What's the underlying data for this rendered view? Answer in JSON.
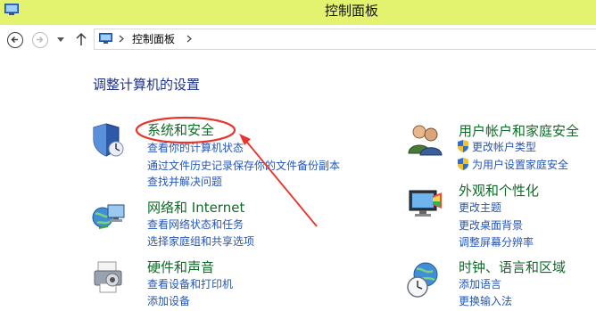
{
  "window": {
    "title": "控制面板"
  },
  "nav": {
    "breadcrumb": "控制面板"
  },
  "main": {
    "heading": "调整计算机的设置"
  },
  "categories": {
    "system_security": {
      "title": "系统和安全",
      "links": [
        "查看你的计算机状态",
        "通过文件历史记录保存你的文件备份副本",
        "查找并解决问题"
      ]
    },
    "network": {
      "title": "网络和 Internet",
      "links": [
        "查看网络状态和任务",
        "选择家庭组和共享选项"
      ]
    },
    "hardware": {
      "title": "硬件和声音",
      "links": [
        "查看设备和打印机",
        "添加设备"
      ]
    },
    "user_accounts": {
      "title": "用户帐户和家庭安全",
      "links": [
        "更改帐户类型",
        "为用户设置家庭安全"
      ]
    },
    "appearance": {
      "title": "外观和个性化",
      "links": [
        "更改主题",
        "更改桌面背景",
        "调整屏幕分辨率"
      ]
    },
    "clock": {
      "title": "时钟、语言和区域",
      "links": [
        "添加语言",
        "更换输入法"
      ]
    }
  },
  "colors": {
    "titlebar": "#e3f26f",
    "category_title": "#0f6b28",
    "link": "#2456b8",
    "annotation": "#e8352a"
  }
}
